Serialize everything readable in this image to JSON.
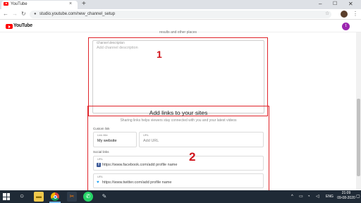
{
  "browser": {
    "tab": {
      "title": "YouTube",
      "close_glyph": "×"
    },
    "new_tab_glyph": "+",
    "window_controls": {
      "minimize": "–",
      "maximize": "☐",
      "close": "✕"
    },
    "nav": {
      "back": "←",
      "forward": "→",
      "reload": "↻"
    },
    "address_bar": {
      "url": "studio.youtube.com/new_channel_setup",
      "lock_icon": "lock-icon"
    },
    "star_glyph": "☆",
    "menu_glyph": "⋮"
  },
  "youtube_header": {
    "logo_text": "YouTube",
    "avatar_letter": "t",
    "avatar_color": "#9c27b0"
  },
  "page": {
    "top_text": "results and other places",
    "channel_description": {
      "label": "Channel description",
      "placeholder": "Add channel description"
    },
    "links_section": {
      "title": "Add links to your sites",
      "subtitle": "Sharing links helps viewers stay connected with you and your latest videos",
      "custom_links_label": "Custom link",
      "link_title": {
        "label": "Link title",
        "value": "My website"
      },
      "url": {
        "label": "URL",
        "placeholder": "Add URL"
      },
      "social_links_label": "Social links",
      "facebook": {
        "label": "URL",
        "value": "https://www.facebook.com/add profile name"
      },
      "twitter": {
        "label": "URL",
        "value": "https://www.twitter.com/add profile name"
      }
    }
  },
  "annotations": {
    "box_1_label": "1",
    "box_2_label": "2",
    "color": "#e0252b"
  },
  "taskbar": {
    "search_glyph": "○",
    "snip_glyph": "✂",
    "whatsapp_glyph": "✆",
    "other_glyph": "✎",
    "tray": {
      "up_glyph": "^",
      "battery_glyph": "▭",
      "network_glyph": "◔",
      "volume_glyph": "◁",
      "language": "ENG",
      "time": "21:09",
      "date": "09-08-2020",
      "notify_glyph": "▢"
    }
  }
}
